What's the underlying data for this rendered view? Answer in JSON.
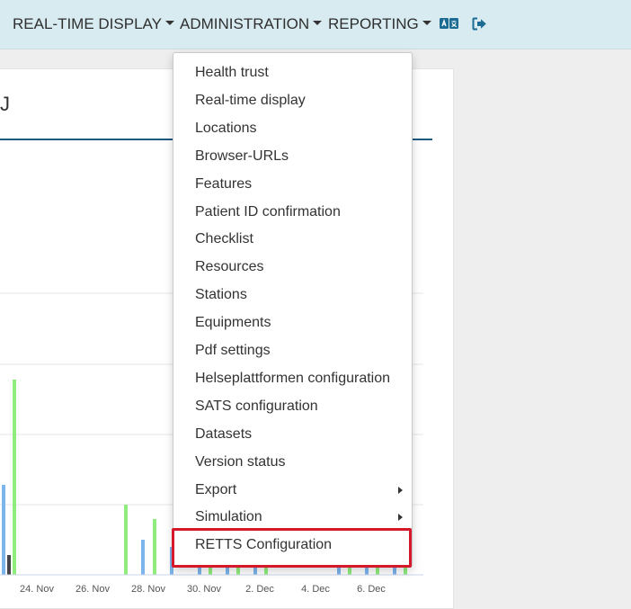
{
  "nav": {
    "realtime_label": "REAL-TIME DISPLAY",
    "admin_label": "ADMINISTRATION",
    "reporting_label": "REPORTING",
    "translate_icon": "translate-icon",
    "logout_icon": "sign-out-icon",
    "icon_color": "#1c6b93"
  },
  "card": {
    "title_fragment": "J"
  },
  "admin_menu": {
    "items": [
      {
        "label": "Health trust"
      },
      {
        "label": "Real-time display"
      },
      {
        "label": "Locations"
      },
      {
        "label": "Browser-URLs"
      },
      {
        "label": "Features"
      },
      {
        "label": "Patient ID confirmation"
      },
      {
        "label": "Checklist"
      },
      {
        "label": "Resources"
      },
      {
        "label": "Stations"
      },
      {
        "label": "Equipments"
      },
      {
        "label": "Pdf settings"
      },
      {
        "label": "Helseplattformen configuration"
      },
      {
        "label": "SATS configuration"
      },
      {
        "label": "Datasets"
      },
      {
        "label": "Version status"
      },
      {
        "label": "Export",
        "submenu": true
      },
      {
        "label": "Simulation",
        "submenu": true
      },
      {
        "label": "RETTS Configuration",
        "highlighted": true
      }
    ],
    "highlight_color": "#d5182a"
  },
  "chart_data": {
    "type": "bar",
    "x_tick_labels": [
      "24. Nov",
      "26. Nov",
      "28. Nov",
      "30. Nov",
      "2. Dec",
      "4. Dec",
      "6. Dec"
    ],
    "series_colors": [
      "#7cb5ec",
      "#434348",
      "#90ed7d"
    ],
    "grid": true
  }
}
